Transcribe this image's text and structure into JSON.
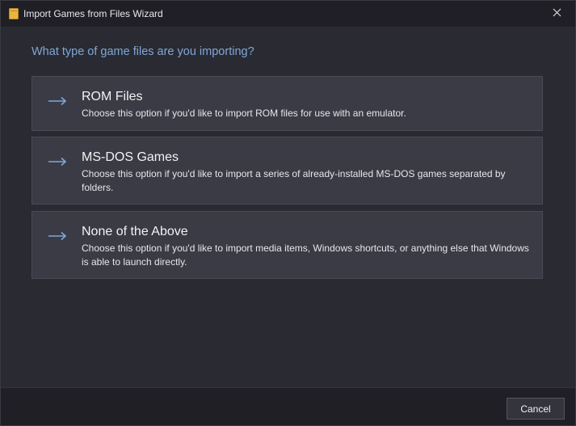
{
  "window": {
    "title": "Import Games from Files Wizard",
    "icon": "folder-icon"
  },
  "heading": "What type of game files are you importing?",
  "options": [
    {
      "title": "ROM Files",
      "description": "Choose this option if you'd like to import ROM files for use with an emulator.",
      "icon": "arrow-right-icon"
    },
    {
      "title": "MS-DOS Games",
      "description": "Choose this option if you'd like to import a series of already-installed MS-DOS games separated by folders.",
      "icon": "arrow-right-icon"
    },
    {
      "title": "None of the Above",
      "description": "Choose this option if you'd like to import media items, Windows shortcuts, or anything else that Windows is able to launch directly.",
      "icon": "arrow-right-icon"
    }
  ],
  "footer": {
    "cancel_label": "Cancel"
  },
  "colors": {
    "accent": "#7fa7d6",
    "background": "#2a2a32",
    "card": "#3b3b46"
  }
}
